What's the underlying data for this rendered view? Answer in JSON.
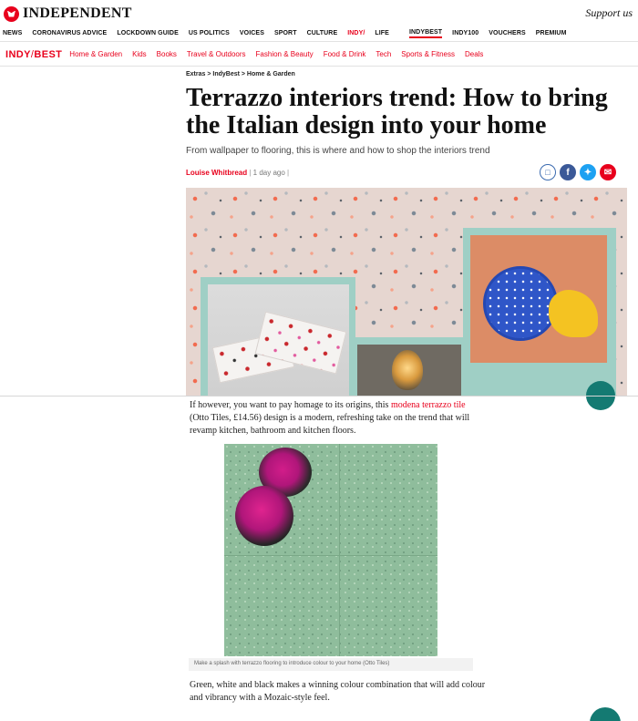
{
  "header": {
    "logo_text": "INDEPENDENT",
    "support_link": "Support us"
  },
  "main_nav": [
    "NEWS",
    "CORONAVIRUS ADVICE",
    "LOCKDOWN GUIDE",
    "US POLITICS",
    "VOICES",
    "SPORT",
    "CULTURE",
    "INDY/LIFE",
    "INDYBEST",
    "INDY100",
    "VOUCHERS",
    "PREMIUM"
  ],
  "indy_life": {
    "prefix": "INDY/",
    "suffix": "LIFE"
  },
  "subnav": {
    "logo_left": "INDY",
    "logo_bar": "/",
    "logo_right": "BEST",
    "items": [
      "Home & Garden",
      "Kids",
      "Books",
      "Travel & Outdoors",
      "Fashion & Beauty",
      "Food & Drink",
      "Tech",
      "Sports & Fitness",
      "Deals"
    ]
  },
  "article": {
    "breadcrumb": "Extras > IndyBest > Home & Garden",
    "title": "Terrazzo interiors trend: How to bring the Italian design into your home",
    "subtitle": "From wallpaper to flooring, this is where and how to shop the interiors trend",
    "author": "Louise Whitbread",
    "separator": "|",
    "time": "1 day ago",
    "share_icons": [
      "bookmark-icon",
      "facebook-icon",
      "twitter-icon",
      "email-icon"
    ],
    "p1_before": "If however, you want to pay homage to its origins, this ",
    "p1_link": "modena terrazzo tile",
    "p1_after": " (Otto Tiles, £14.56) design is a modern, refreshing take on the trend that will revamp kitchen, bathroom and kitchen floors.",
    "caption": "Make a splash with terrazzo flooring to introduce colour to your home (Otto Tiles)",
    "p2": "Green, white and black makes a winning colour combination that will add colour and vibrancy with a Mozaic-style feel."
  },
  "colors": {
    "brand_red": "#e8001c",
    "facebook": "#3b5998",
    "twitter": "#1da1f2",
    "fab_teal": "#147a72"
  }
}
